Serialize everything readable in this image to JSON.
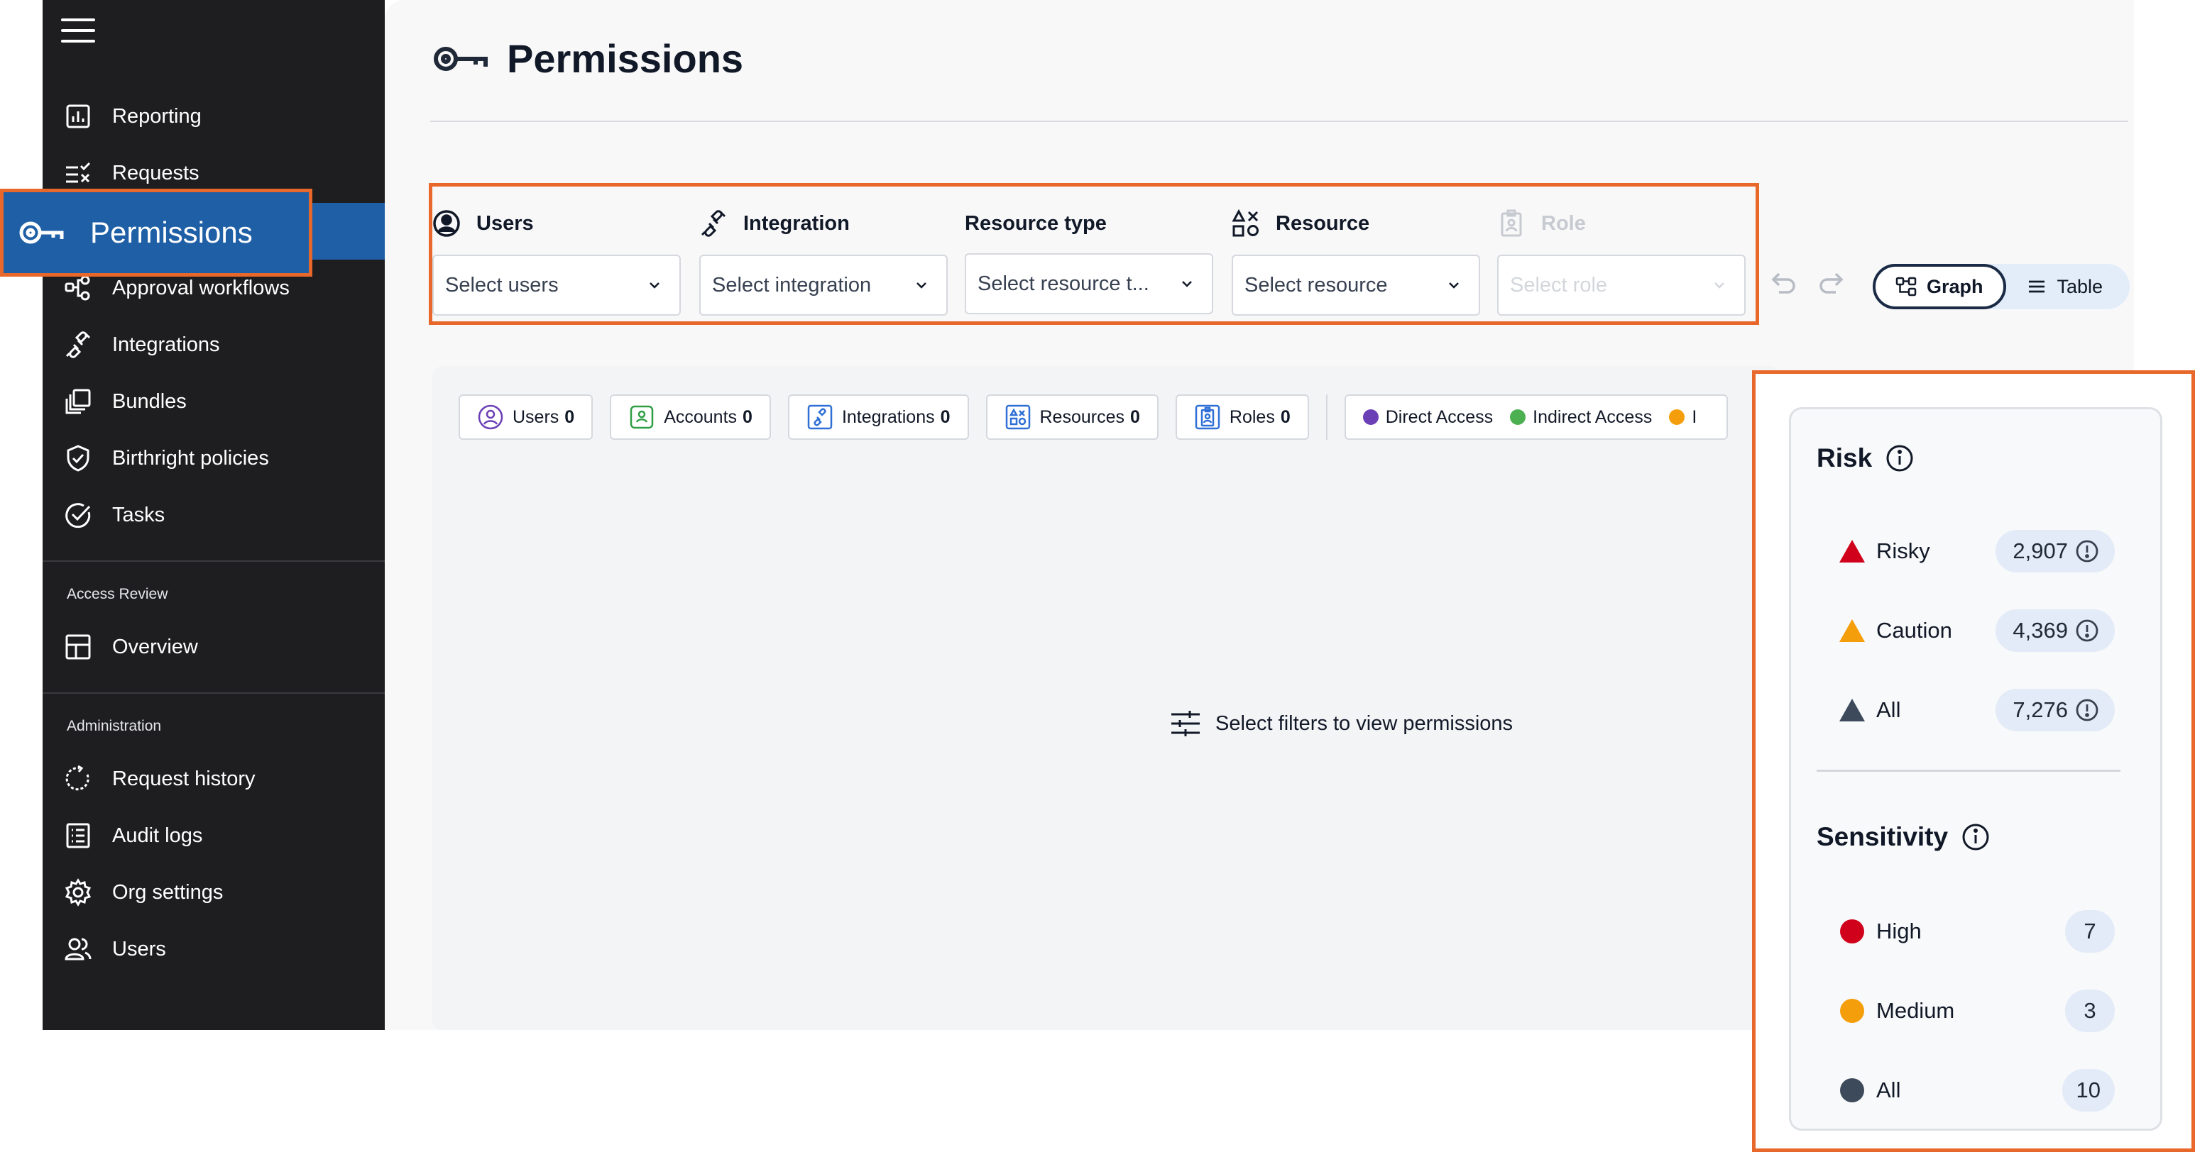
{
  "sidebar": {
    "items": [
      {
        "label": "Reporting",
        "icon": "chart-icon"
      },
      {
        "label": "Requests",
        "icon": "checklist-icon"
      },
      {
        "label": "Permissions",
        "icon": "key-icon"
      },
      {
        "label": "Approval workflows",
        "icon": "workflow-icon"
      },
      {
        "label": "Integrations",
        "icon": "plug-icon"
      },
      {
        "label": "Bundles",
        "icon": "bundles-icon"
      },
      {
        "label": "Birthright policies",
        "icon": "shield-check-icon"
      },
      {
        "label": "Tasks",
        "icon": "check-circle-icon"
      }
    ],
    "access_review": {
      "title": "Access Review",
      "items": [
        {
          "label": "Overview",
          "icon": "layout-icon"
        }
      ]
    },
    "administration": {
      "title": "Administration",
      "items": [
        {
          "label": "Request history",
          "icon": "history-icon"
        },
        {
          "label": "Audit logs",
          "icon": "list-icon"
        },
        {
          "label": "Org settings",
          "icon": "gear-icon"
        },
        {
          "label": "Users",
          "icon": "users-icon"
        }
      ]
    }
  },
  "page": {
    "title": "Permissions"
  },
  "filters": {
    "users": {
      "label": "Users",
      "placeholder": "Select users"
    },
    "integration": {
      "label": "Integration",
      "placeholder": "Select integration"
    },
    "resource_type": {
      "label": "Resource type",
      "placeholder": "Select resource t..."
    },
    "resource": {
      "label": "Resource",
      "placeholder": "Select resource"
    },
    "role": {
      "label": "Role",
      "placeholder": "Select role",
      "disabled": true
    }
  },
  "view_toggle": {
    "graph_label": "Graph",
    "table_label": "Table",
    "selected": "Graph"
  },
  "legend": {
    "chips": [
      {
        "label": "Users",
        "count": "0",
        "color": "#6b3fb5"
      },
      {
        "label": "Accounts",
        "count": "0",
        "color": "#2f9e44"
      },
      {
        "label": "Integrations",
        "count": "0",
        "color": "#2f6fd6"
      },
      {
        "label": "Resources",
        "count": "0",
        "color": "#2f6fd6"
      },
      {
        "label": "Roles",
        "count": "0",
        "color": "#2f6fd6"
      }
    ],
    "access": [
      {
        "label": "Direct Access",
        "color": "#6b3fb5"
      },
      {
        "label": "Indirect Access",
        "color": "#4caf50"
      },
      {
        "label": "I",
        "color": "#f59e0b"
      }
    ]
  },
  "empty_state": {
    "message": "Select filters to view permissions"
  },
  "risk_panel": {
    "risk_title": "Risk",
    "risk_rows": [
      {
        "label": "Risky",
        "value": "2,907",
        "color": "#d0021b"
      },
      {
        "label": "Caution",
        "value": "4,369",
        "color": "#f59e0b"
      },
      {
        "label": "All",
        "value": "7,276",
        "color": "#3d4a5c"
      }
    ],
    "sensitivity_title": "Sensitivity",
    "sensitivity_rows": [
      {
        "label": "High",
        "value": "7",
        "color": "#d0021b"
      },
      {
        "label": "Medium",
        "value": "3",
        "color": "#f59e0b"
      },
      {
        "label": "All",
        "value": "10",
        "color": "#3d4a5c"
      }
    ]
  }
}
